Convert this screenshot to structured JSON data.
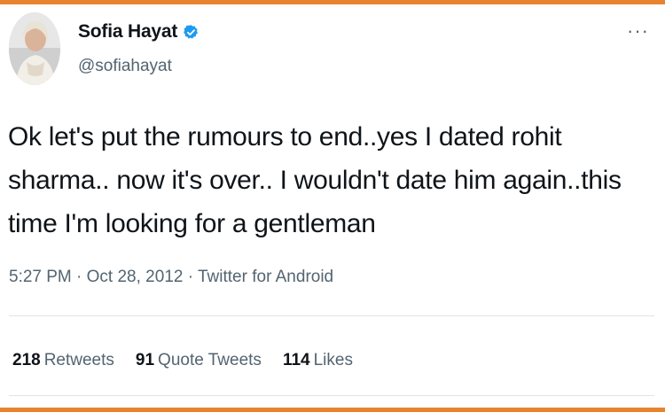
{
  "tweet": {
    "author": {
      "display_name": "Sofia Hayat",
      "handle": "@sofiahayat",
      "verified": true
    },
    "text": "Ok let's put the rumours to end..yes I dated rohit sharma.. now it's over.. I wouldn't date him again..this time I'm looking for a gentleman",
    "meta": {
      "time": "5:27 PM",
      "separator": " · ",
      "date": "Oct 28, 2012",
      "source": "Twitter for Android"
    },
    "more_icon": "more-horizontal-icon",
    "stats": {
      "retweets_count": "218",
      "retweets_label": "Retweets",
      "quote_count": "91",
      "quote_label": "Quote Tweets",
      "likes_count": "114",
      "likes_label": "Likes"
    }
  },
  "colors": {
    "accent_bar": "#e8832f",
    "verified_blue": "#1d9bf0",
    "text_primary": "#0f1419",
    "text_secondary": "#536471"
  }
}
